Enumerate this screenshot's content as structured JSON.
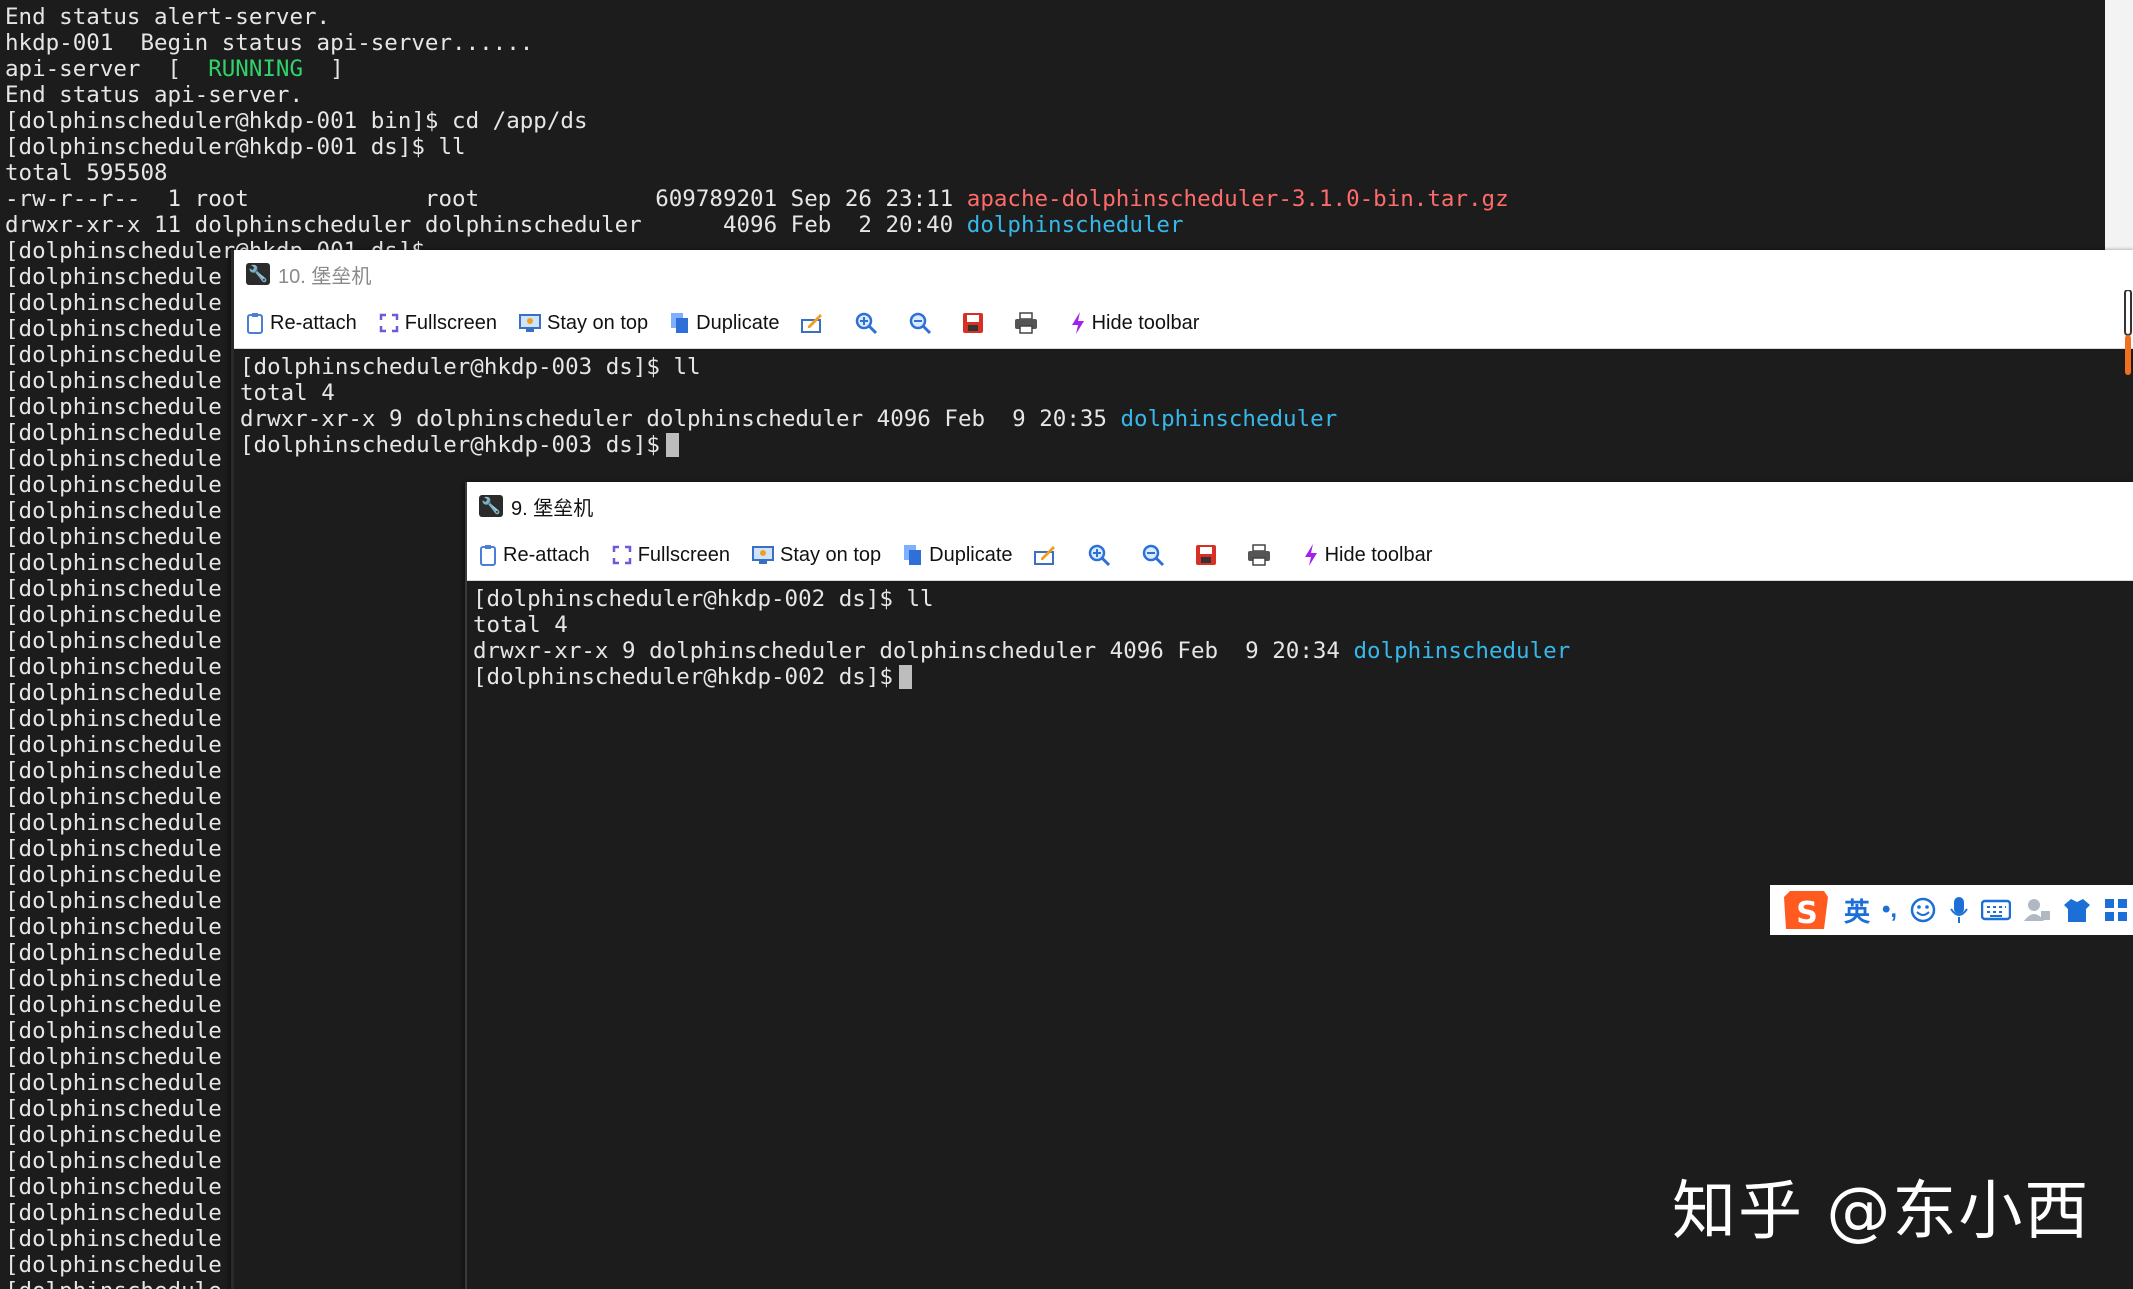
{
  "background_terminal": {
    "lines": [
      [
        {
          "t": "End status alert-server."
        }
      ],
      [
        {
          "t": "hkdp-001  Begin status api-server......"
        }
      ],
      [
        {
          "t": "api-server  [  "
        },
        {
          "t": "RUNNING",
          "c": "c-green"
        },
        {
          "t": "  ]"
        }
      ],
      [
        {
          "t": "End status api-server."
        }
      ],
      [
        {
          "t": "[dolphinscheduler@hkdp-001 bin]$ cd /app/ds"
        }
      ],
      [
        {
          "t": "[dolphinscheduler@hkdp-001 ds]$ ll"
        }
      ],
      [
        {
          "t": "total 595508"
        }
      ],
      [
        {
          "t": "-rw-r--r--  1 root             root             609789201 Sep 26 23:11 "
        },
        {
          "t": "apache-dolphinscheduler-3.1.0-bin.tar.gz",
          "c": "c-red"
        }
      ],
      [
        {
          "t": "drwxr-xr-x 11 dolphinscheduler dolphinscheduler      4096 Feb  2 20:40 "
        },
        {
          "t": "dolphinscheduler",
          "c": "c-cyan"
        }
      ],
      [
        {
          "t": "[dolphinscheduler@hkdp-001 ds]$"
        }
      ]
    ],
    "truncated_prompt": "[dolphinschedule",
    "truncated_prompt_count": 40
  },
  "window_10": {
    "title": "10. 堡垒机",
    "toolbar": {
      "reattach": "Re-attach",
      "fullscreen": "Fullscreen",
      "stay_on_top": "Stay on top",
      "duplicate": "Duplicate",
      "hide_toolbar": "Hide toolbar"
    },
    "lines": [
      [
        {
          "t": "[dolphinscheduler@hkdp-003 ds]$ ll"
        }
      ],
      [
        {
          "t": "total 4"
        }
      ],
      [
        {
          "t": "drwxr-xr-x 9 dolphinscheduler dolphinscheduler 4096 Feb  9 20:35 "
        },
        {
          "t": "dolphinscheduler",
          "c": "c-cyan"
        }
      ],
      [
        {
          "t": "[dolphinscheduler@hkdp-003 ds]$",
          "cursor": true
        }
      ]
    ]
  },
  "window_9": {
    "title": "9. 堡垒机",
    "toolbar": {
      "reattach": "Re-attach",
      "fullscreen": "Fullscreen",
      "stay_on_top": "Stay on top",
      "duplicate": "Duplicate",
      "hide_toolbar": "Hide toolbar"
    },
    "lines": [
      [
        {
          "t": "[dolphinscheduler@hkdp-002 ds]$ ll"
        }
      ],
      [
        {
          "t": "total 4"
        }
      ],
      [
        {
          "t": "drwxr-xr-x 9 dolphinscheduler dolphinscheduler 4096 Feb  9 20:34 "
        },
        {
          "t": "dolphinscheduler",
          "c": "c-cyan"
        }
      ],
      [
        {
          "t": "[dolphinscheduler@hkdp-002 ds]$",
          "cursor": true
        }
      ]
    ]
  },
  "ime_bar": {
    "lang": "英",
    "punct": "•,",
    "icons": [
      "sogou-logo-icon",
      "emoji-icon",
      "microphone-icon",
      "keyboard-icon",
      "user-icon",
      "skin-icon",
      "grid-icon"
    ]
  },
  "watermark": "知乎 @东小西",
  "colors": {
    "green": "#2fd36a",
    "red": "#ff6b6b",
    "cyan": "#36b8ea"
  }
}
